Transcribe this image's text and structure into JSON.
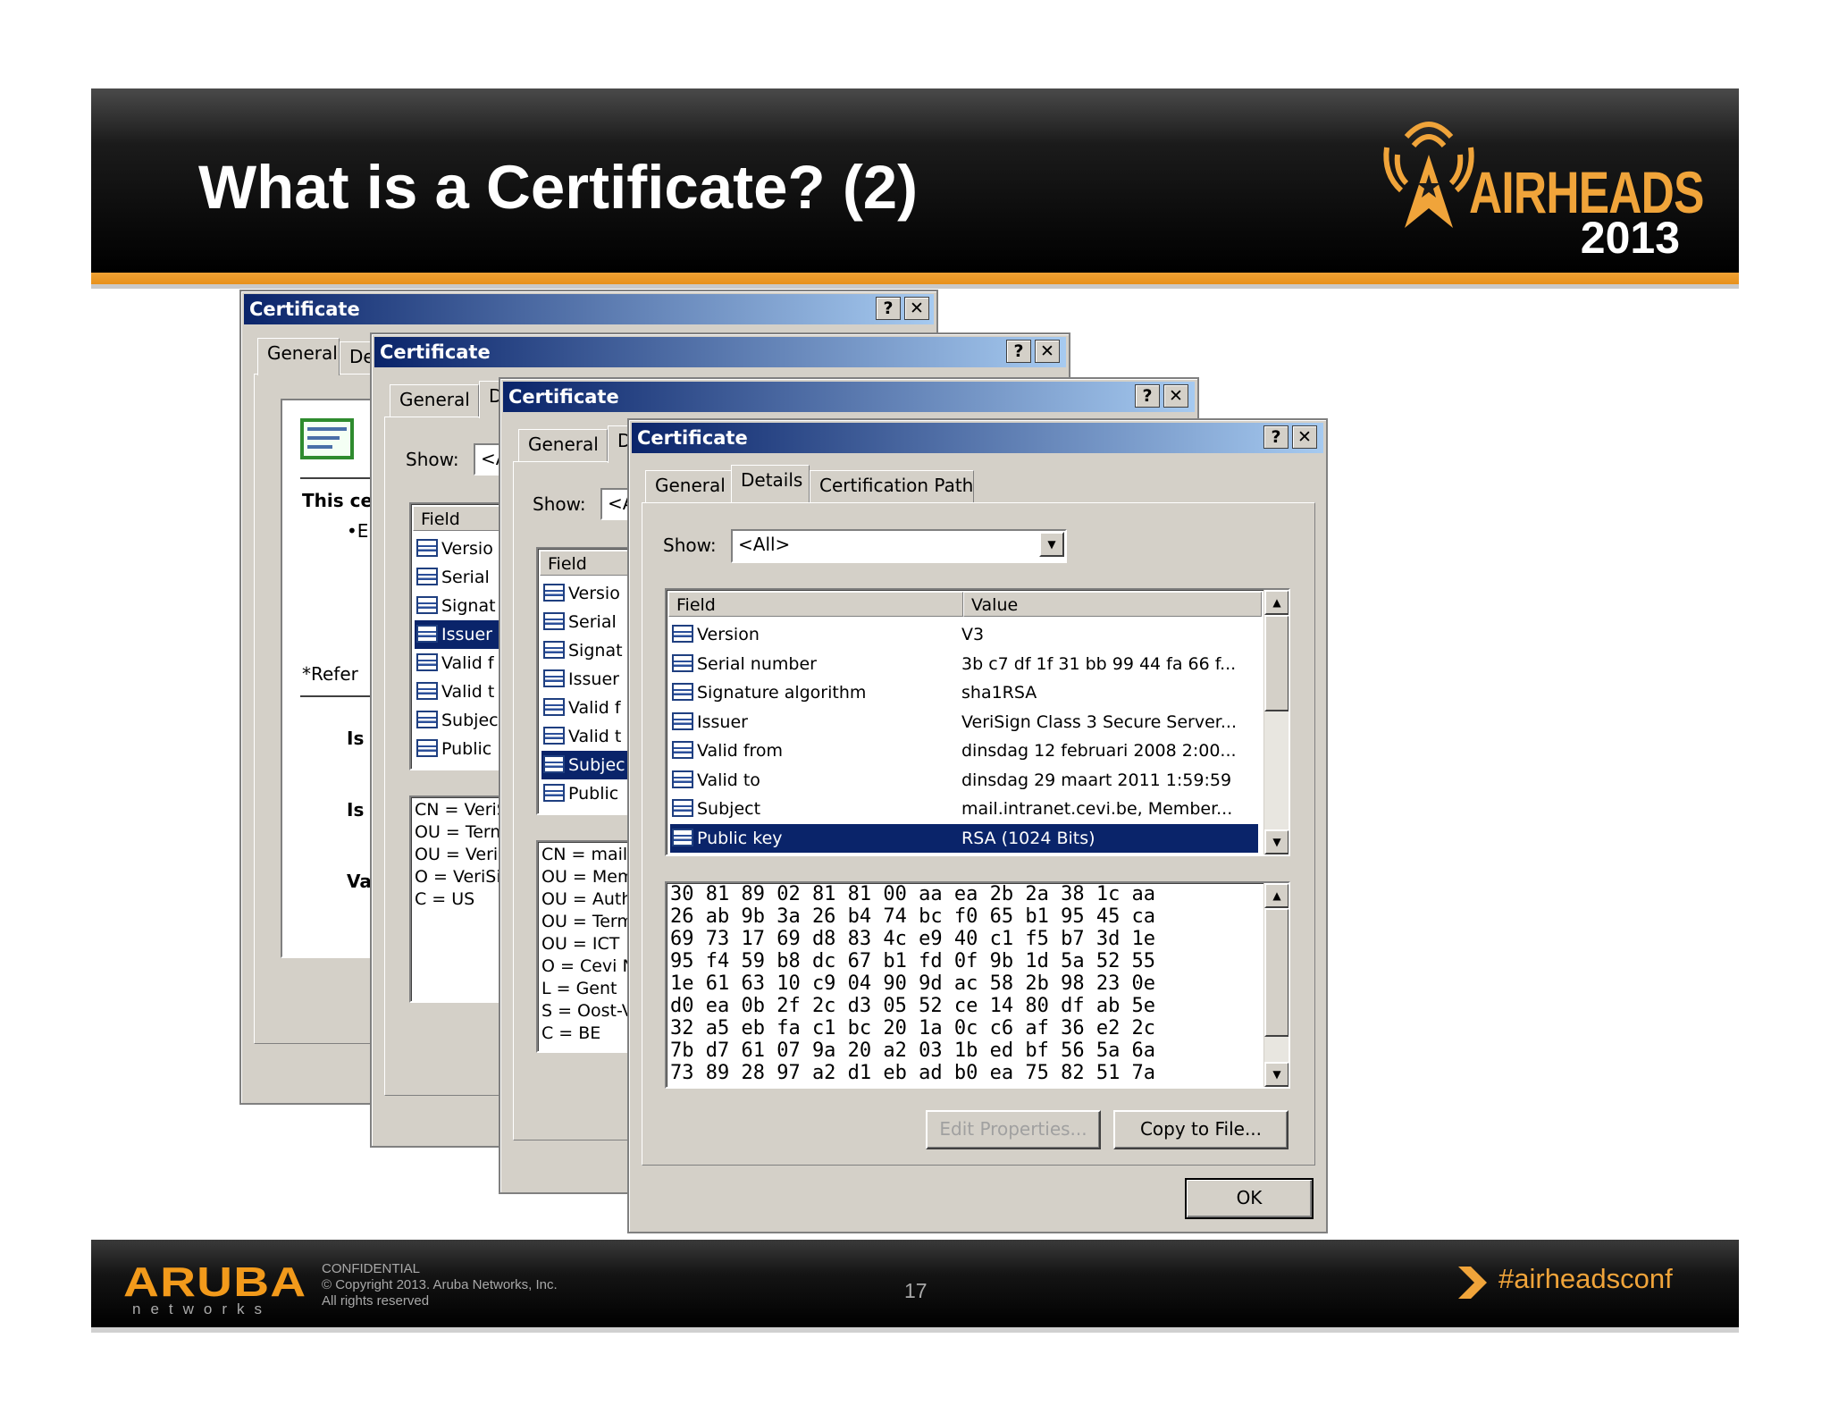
{
  "slide": {
    "title": "What is a Certificate? (2)",
    "logo_word": "AIRHEADS",
    "logo_year": "2013",
    "footer_brand": "ARUBA",
    "footer_brand_sub": "networks",
    "footer_lines": [
      "CONFIDENTIAL",
      "© Copyright 2013. Aruba Networks, Inc.",
      "All rights reserved"
    ],
    "page_number": "17",
    "hashtag": "#airheadsconf",
    "colors": {
      "accent": "#f0a43a",
      "selection": "#0a246a",
      "dialog": "#d4d0c8"
    }
  },
  "dialogs": {
    "title": "Certificate",
    "help_glyph": "?",
    "close_glyph": "✕",
    "tab_general": "General",
    "tab_details_cut": "De",
    "tab_details": "Details",
    "tab_path": "Certification Path",
    "show_label": "Show:",
    "show_cut": "<A",
    "w1": {
      "intro": "This ce",
      "bullet": "•E",
      "refer": "*Refer",
      "issued_to": "Is",
      "issued_by": "Is",
      "valid": "Va"
    },
    "w2": {
      "field_header": "Field",
      "fields": [
        "Versio",
        "Serial",
        "Signat",
        "Issuer",
        "Valid f",
        "Valid t",
        "Subjec",
        "Public"
      ],
      "value_lines": [
        "CN = VeriS",
        "OU = Term",
        "OU = VeriS",
        "O = VeriSig",
        "C = US"
      ]
    },
    "w3": {
      "field_header": "Field",
      "fields": [
        "Versio",
        "Serial",
        "Signat",
        "Issuer",
        "Valid f",
        "Valid t",
        "Subjec",
        "Public"
      ],
      "value_lines": [
        "CN = mail.",
        "OU = Mem",
        "OU = Auth",
        "OU = Term",
        "OU = ICT",
        "O = Cevi N",
        "L = Gent",
        "S = Oost-V",
        "C = BE"
      ]
    },
    "main": {
      "show_value": "<All>",
      "col_field": "Field",
      "col_value": "Value",
      "rows": [
        {
          "field": "Version",
          "value": "V3"
        },
        {
          "field": "Serial number",
          "value": "3b c7 df 1f 31 bb 99 44 fa 66 f..."
        },
        {
          "field": "Signature algorithm",
          "value": "sha1RSA"
        },
        {
          "field": "Issuer",
          "value": "VeriSign Class 3 Secure Server..."
        },
        {
          "field": "Valid from",
          "value": "dinsdag 12 februari 2008 2:00..."
        },
        {
          "field": "Valid to",
          "value": "dinsdag 29 maart 2011 1:59:59"
        },
        {
          "field": "Subject",
          "value": "mail.intranet.cevi.be, Member..."
        },
        {
          "field": "Public key",
          "value": "RSA (1024 Bits)"
        }
      ],
      "hex_lines": [
        "30 81 89 02 81 81 00 aa ea 2b 2a 38 1c aa",
        "26 ab 9b 3a 26 b4 74 bc f0 65 b1 95 45 ca",
        "69 73 17 69 d8 83 4c e9 40 c1 f5 b7 3d 1e",
        "95 f4 59 b8 dc 67 b1 fd 0f 9b 1d 5a 52 55",
        "1e 61 63 10 c9 04 90 9d ac 58 2b 98 23 0e",
        "d0 ea 0b 2f 2c d3 05 52 ce 14 80 df ab 5e",
        "32 a5 eb fa c1 bc 20 1a 0c c6 af 36 e2 2c",
        "7b d7 61 07 9a 20 a2 03 1b ed bf 56 5a 6a",
        "73 89 28 97 a2 d1 eb ad b0 ea 75 82 51 7a"
      ],
      "edit_properties": "Edit Properties...",
      "copy_to_file": "Copy to File...",
      "ok": "OK"
    }
  }
}
